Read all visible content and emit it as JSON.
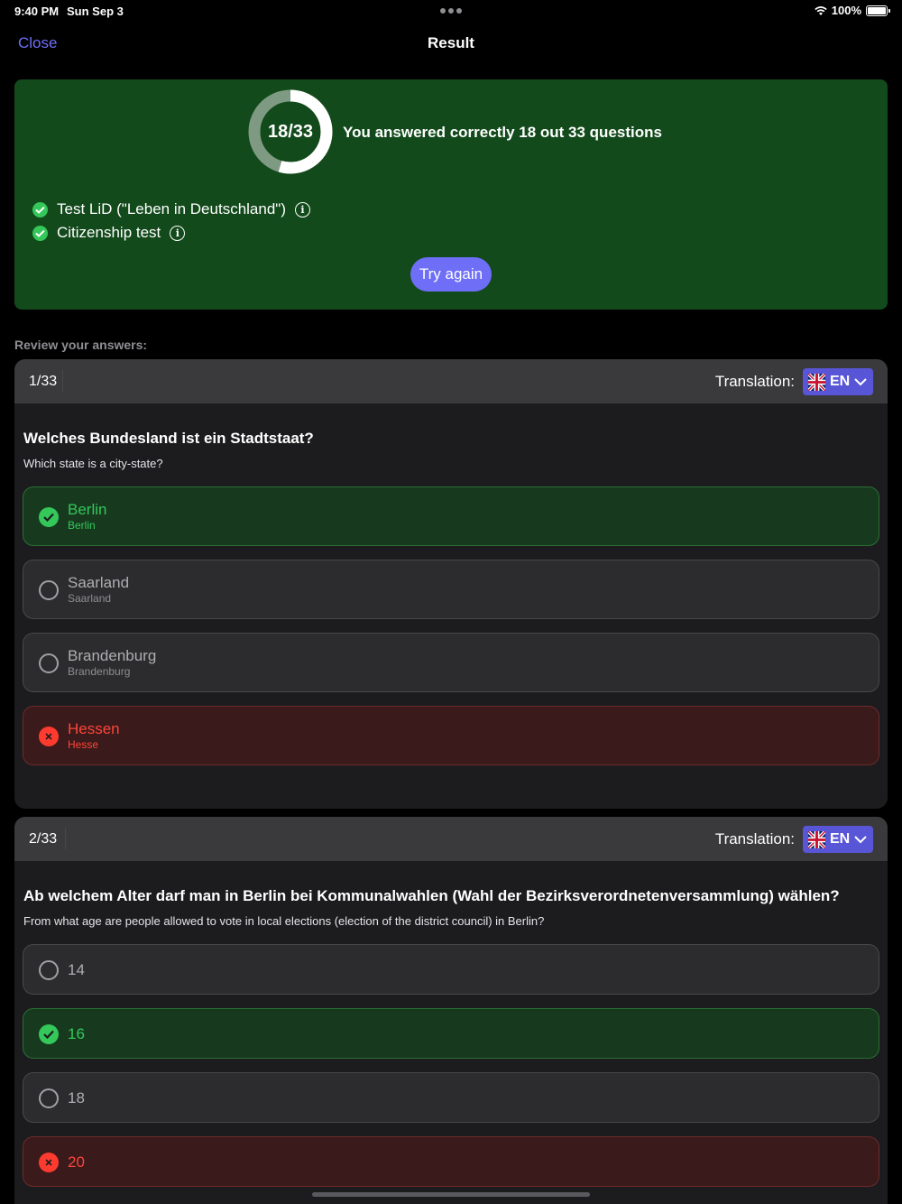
{
  "status": {
    "time": "9:40 PM",
    "date": "Sun Sep 3",
    "battery": "100%"
  },
  "nav": {
    "close": "Close",
    "title": "Result"
  },
  "result": {
    "score_label": "18/33",
    "correct": 18,
    "total": 33,
    "summary": "You answered correctly 18 out 33 questions",
    "certs": [
      "Test LiD (\"Leben in Deutschland\")",
      "Citizenship test"
    ],
    "try_again": "Try again",
    "colors": {
      "card": "#124a1b",
      "accent": "#6e6ef7"
    }
  },
  "review_label": "Review your answers:",
  "questions": [
    {
      "number": "1/33",
      "translation_label": "Translation:",
      "lang": "EN",
      "title": "Welches Bundesland ist ein Stadtstaat?",
      "subtitle": "Which state is a city-state?",
      "answers": [
        {
          "text": "Berlin",
          "translation": "Berlin",
          "state": "correct"
        },
        {
          "text": "Saarland",
          "translation": "Saarland",
          "state": "none"
        },
        {
          "text": "Brandenburg",
          "translation": "Brandenburg",
          "state": "none"
        },
        {
          "text": "Hessen",
          "translation": "Hesse",
          "state": "wrong"
        }
      ]
    },
    {
      "number": "2/33",
      "translation_label": "Translation:",
      "lang": "EN",
      "title": "Ab welchem Alter darf man in Berlin bei Kommunalwahlen (Wahl der Bezirksverordnetenversammlung) wählen?",
      "subtitle": "From what age are people allowed to vote in local elections (election of the district council) in Berlin?",
      "answers": [
        {
          "text": "14",
          "state": "none"
        },
        {
          "text": "16",
          "state": "correct"
        },
        {
          "text": "18",
          "state": "none"
        },
        {
          "text": "20",
          "state": "wrong"
        }
      ]
    }
  ]
}
